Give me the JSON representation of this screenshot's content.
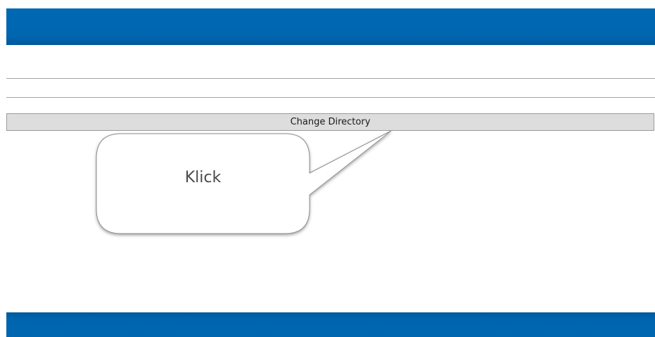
{
  "toolbar": {
    "change_directory_label": "Change Directory"
  },
  "callout": {
    "text": "Klick"
  },
  "colors": {
    "header_bar": "#0066b0",
    "footer_bar": "#0066b0",
    "button_background": "#dddddd",
    "divider": "#a6a6a6"
  }
}
